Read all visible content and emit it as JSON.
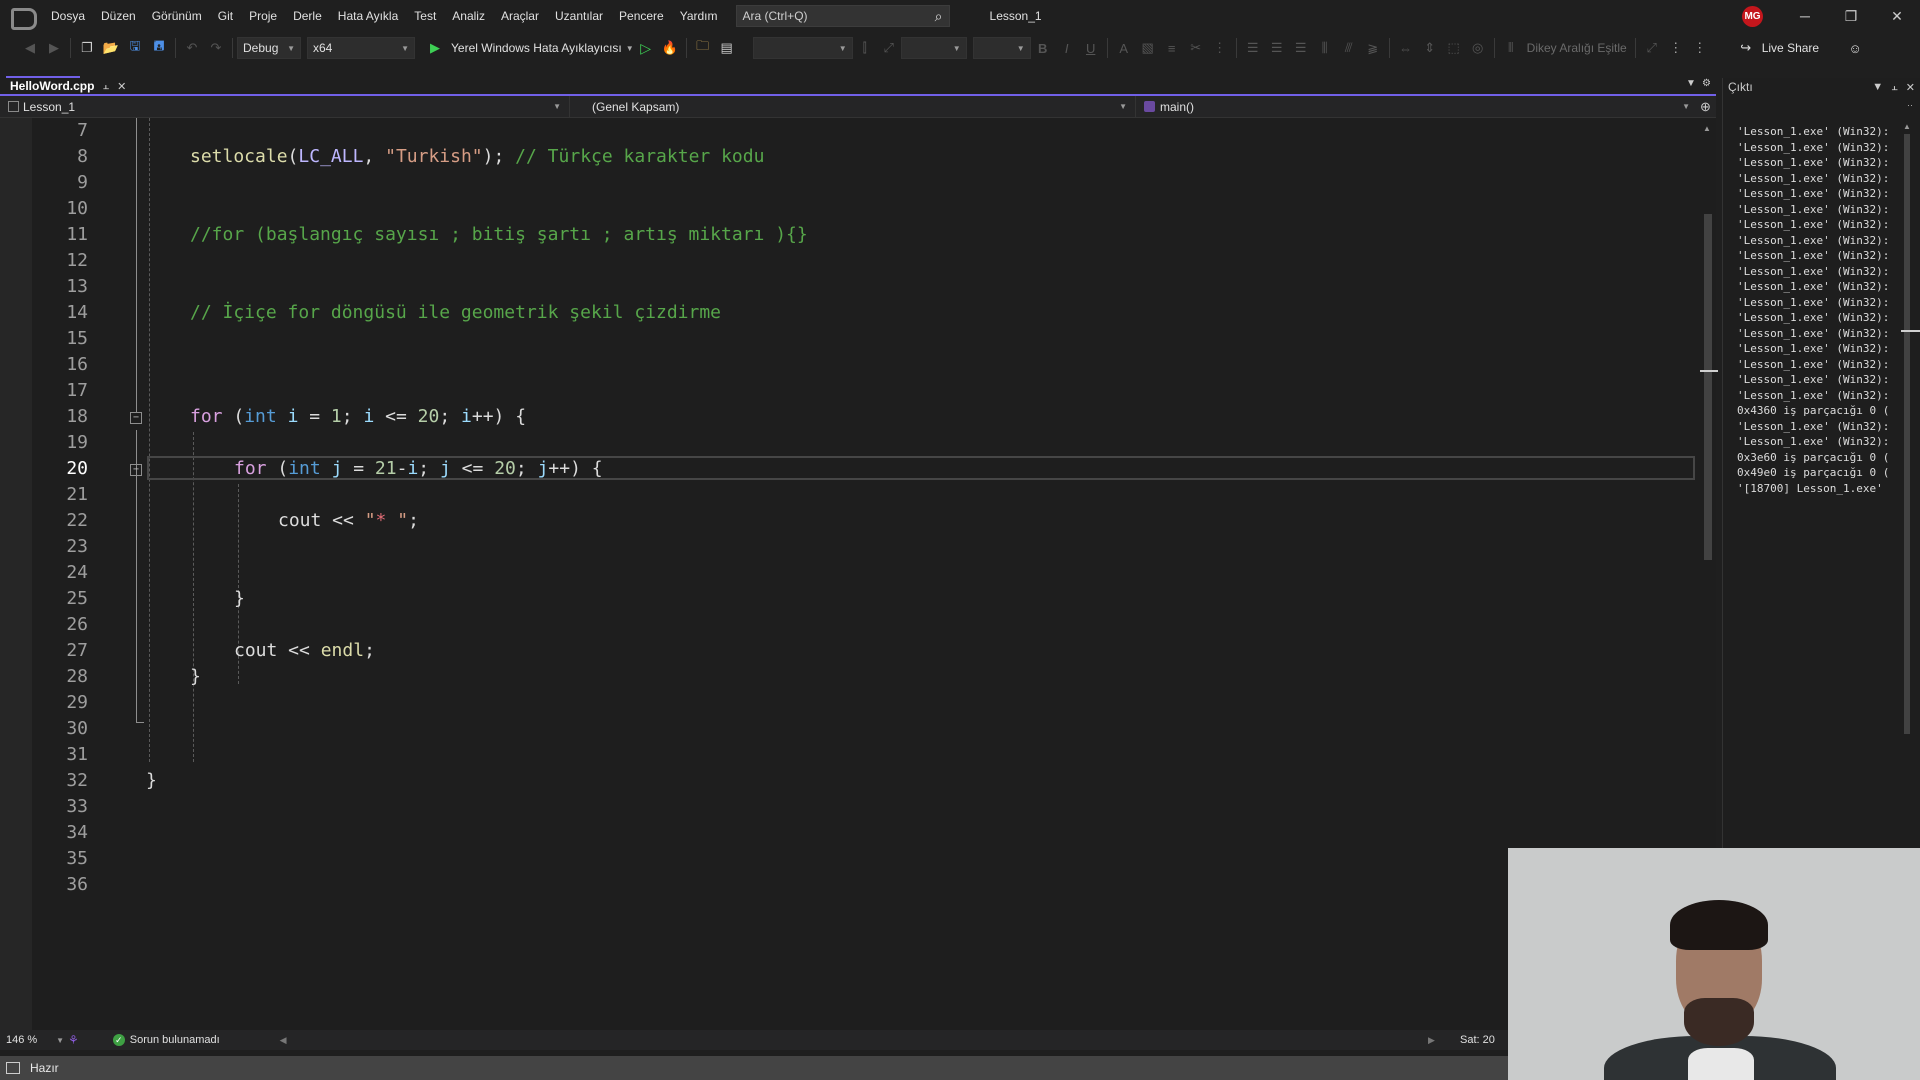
{
  "menubar": {
    "items": [
      "Dosya",
      "Düzen",
      "Görünüm",
      "Git",
      "Proje",
      "Derle",
      "Hata Ayıkla",
      "Test",
      "Analiz",
      "Araçlar",
      "Uzantılar",
      "Pencere",
      "Yardım"
    ],
    "search_placeholder": "Ara (Ctrl+Q)",
    "solution_name": "Lesson_1",
    "user_initials": "MG",
    "user_badge_color": "#c4161c"
  },
  "toolbar": {
    "configuration": "Debug",
    "platform": "x64",
    "debug_target": "Yerel Windows Hata Ayıklayıcısı",
    "equalize_vertical_spacing": "Dikey Aralığı Eşitle",
    "live_share": "Live Share"
  },
  "tabs": {
    "active_file": "HelloWord.cpp"
  },
  "navbar": {
    "project": "Lesson_1",
    "scope": "(Genel Kapsam)",
    "member": "main()"
  },
  "editor": {
    "current_line": 20,
    "accent_color": "#7160e8",
    "lines": [
      {
        "n": "7"
      },
      {
        "n": "8"
      },
      {
        "n": "9"
      },
      {
        "n": "10"
      },
      {
        "n": "11"
      },
      {
        "n": "12"
      },
      {
        "n": "13"
      },
      {
        "n": "14"
      },
      {
        "n": "15"
      },
      {
        "n": "16"
      },
      {
        "n": "17"
      },
      {
        "n": "18"
      },
      {
        "n": "19"
      },
      {
        "n": "20"
      },
      {
        "n": "21"
      },
      {
        "n": "22"
      },
      {
        "n": "23"
      },
      {
        "n": "24"
      },
      {
        "n": "25"
      },
      {
        "n": "26"
      },
      {
        "n": "27"
      },
      {
        "n": "28"
      },
      {
        "n": "29"
      },
      {
        "n": "30"
      },
      {
        "n": "31"
      },
      {
        "n": "32"
      },
      {
        "n": "33"
      },
      {
        "n": "34"
      },
      {
        "n": "35"
      },
      {
        "n": "36"
      }
    ],
    "code": {
      "l8": {
        "fn": "setlocale",
        "p1": "(",
        "mac": "LC_ALL",
        "p2": ", ",
        "str": "\"Turkish\"",
        "p3": "); ",
        "cm": "// Türkçe karakter kodu"
      },
      "l11": {
        "cm": "//for (başlangıç sayısı ; bitiş şartı ; artış miktarı ){}"
      },
      "l14": {
        "cm": "// İçiçe for döngüsü ile geometrik şekil çizdirme"
      },
      "l18": {
        "kw": "for",
        "p1": " (",
        "ty": "int",
        "sp": " ",
        "v1": "i",
        "p2": " = ",
        "n1": "1",
        "p3": "; ",
        "v2": "i",
        "p4": " <= ",
        "n2": "20",
        "p5": "; ",
        "v3": "i",
        "p6": "++) {"
      },
      "l20": {
        "kw": "for",
        "p1": " (",
        "ty": "int",
        "sp": " ",
        "v1": "j",
        "p2": " = ",
        "n1": "21",
        "p3": "-",
        "v2": "i",
        "p4": "; ",
        "v3": "j",
        "p5": " <= ",
        "n2": "20",
        "p6": "; ",
        "v4": "j",
        "p7": "++) {"
      },
      "l22": {
        "a": "cout << ",
        "str1": "\"",
        "star": "*",
        "str2": " \"",
        "b": ";"
      },
      "l25": {
        "a": "}"
      },
      "l27": {
        "a": "cout << ",
        "fn": "endl",
        "b": ";"
      },
      "l28": {
        "a": "}"
      },
      "l32": {
        "a": "}"
      }
    }
  },
  "status": {
    "zoom": "146 %",
    "issues": "Sorun bulunamadı",
    "line_indicator": "Sat: 20",
    "ready": "Hazır"
  },
  "output": {
    "title": "Çıktı",
    "lines": [
      "'Lesson_1.exe' (Win32):",
      "'Lesson_1.exe' (Win32):",
      "'Lesson_1.exe' (Win32):",
      "'Lesson_1.exe' (Win32):",
      "'Lesson_1.exe' (Win32):",
      "'Lesson_1.exe' (Win32):",
      "'Lesson_1.exe' (Win32):",
      "'Lesson_1.exe' (Win32):",
      "'Lesson_1.exe' (Win32):",
      "'Lesson_1.exe' (Win32):",
      "'Lesson_1.exe' (Win32):",
      "'Lesson_1.exe' (Win32):",
      "'Lesson_1.exe' (Win32):",
      "'Lesson_1.exe' (Win32):",
      "'Lesson_1.exe' (Win32):",
      "'Lesson_1.exe' (Win32):",
      "'Lesson_1.exe' (Win32):",
      "'Lesson_1.exe' (Win32):",
      "0x4360 iş parçacığı 0 (",
      "'Lesson_1.exe' (Win32):",
      "'Lesson_1.exe' (Win32):",
      "0x3e60 iş parçacığı 0 (",
      "0x49e0 iş parçacığı 0 (",
      "'[18700] Lesson_1.exe'"
    ]
  },
  "icons": {
    "search": "magnifier-icon",
    "minimize": "─",
    "restore": "❐",
    "close": "✕"
  }
}
